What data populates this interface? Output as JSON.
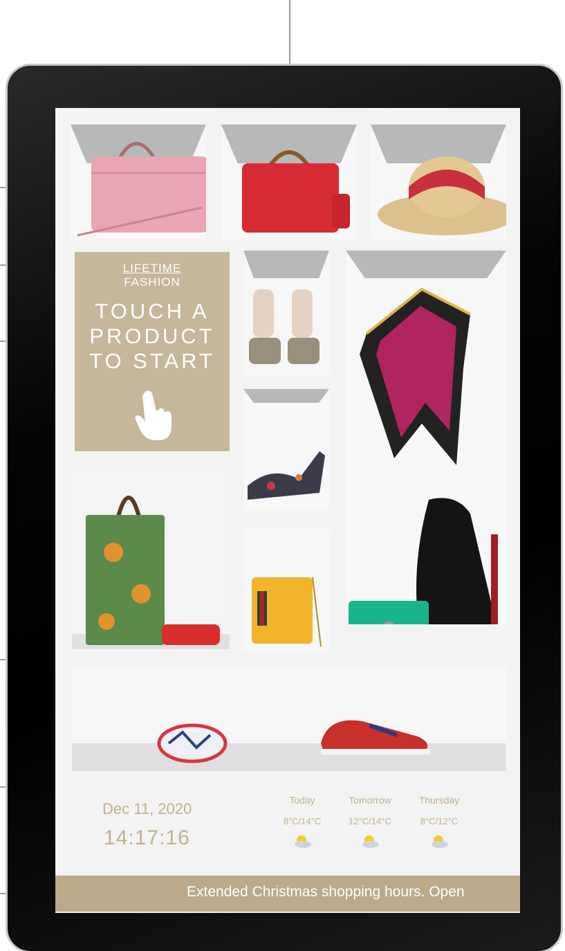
{
  "promo": {
    "line1": "LIFETIME",
    "line2": "FASHION",
    "headline_1": "TOUCH A",
    "headline_2": "PRODUCT",
    "headline_3": "TO START",
    "hand_icon": "pointing-hand-icon"
  },
  "products": [
    {
      "name": "pink-handbag"
    },
    {
      "name": "red-bamboo-handbag"
    },
    {
      "name": "straw-hat"
    },
    {
      "name": "platform-sandals"
    },
    {
      "name": "silk-scarf"
    },
    {
      "name": "floral-heels"
    },
    {
      "name": "tiger-tote-bag"
    },
    {
      "name": "yellow-shoulder-bag"
    },
    {
      "name": "black-hobo-bag"
    },
    {
      "name": "green-clutch"
    },
    {
      "name": "bracelet"
    },
    {
      "name": "sneaker"
    }
  ],
  "clock": {
    "date": "Dec 11, 2020",
    "time": "14:17:16"
  },
  "weather": [
    {
      "day": "Today",
      "temp": "8°C/14°C",
      "icon": "sun-cloud-icon"
    },
    {
      "day": "Tomorrow",
      "temp": "12°C/14°C",
      "icon": "sun-cloud-icon"
    },
    {
      "day": "Thursday",
      "temp": "8°C/12°C",
      "icon": "sun-cloud-icon"
    }
  ],
  "ticker": {
    "text": "Extended Christmas shopping hours. Open"
  },
  "colors": {
    "accent": "#c6b69a",
    "ticker": "#bba98a",
    "text_accent": "#c2b08f"
  }
}
